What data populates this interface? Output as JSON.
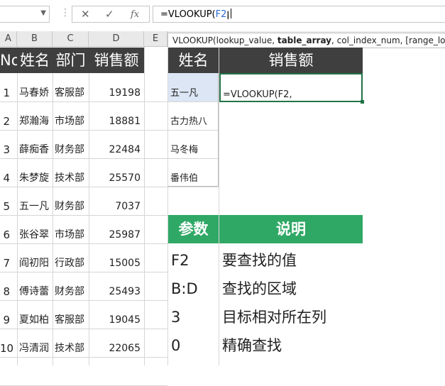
{
  "formula_bar": {
    "cancel_icon": "✕",
    "enter_icon": "✓",
    "fx_icon": "fx",
    "formula_prefix": "=VLOOKUP(",
    "formula_arg": "F2",
    "formula_suffix": ","
  },
  "tooltip": {
    "fn": "VLOOKUP(",
    "arg1": "lookup_value, ",
    "arg2": "table_array",
    "rest": ", col_index_num, [range_looku"
  },
  "columns": [
    "A",
    "B",
    "C",
    "D",
    "E"
  ],
  "left_table": {
    "headers": [
      "No",
      "姓名",
      "部门",
      "销售额"
    ],
    "rows": [
      [
        "1",
        "马春娇",
        "客服部",
        "19198"
      ],
      [
        "2",
        "郑瀚海",
        "市场部",
        "18881"
      ],
      [
        "3",
        "薛痴香",
        "财务部",
        "22484"
      ],
      [
        "4",
        "朱梦旋",
        "技术部",
        "25570"
      ],
      [
        "5",
        "五一凡",
        "财务部",
        "7037"
      ],
      [
        "6",
        "张谷翠",
        "市场部",
        "25987"
      ],
      [
        "7",
        "阎初阳",
        "行政部",
        "15005"
      ],
      [
        "8",
        "傅诗蕾",
        "财务部",
        "25493"
      ],
      [
        "9",
        "夏如柏",
        "客服部",
        "19045"
      ],
      [
        "10",
        "冯清润",
        "技术部",
        "22065"
      ]
    ]
  },
  "lookup_table": {
    "headers": [
      "姓名",
      "销售额"
    ],
    "names": [
      "五一凡",
      "古力热八",
      "马冬梅",
      "番伟伯"
    ],
    "active_formula": "=VLOOKUP(F2,"
  },
  "explain_table": {
    "headers": [
      "参数",
      "说明"
    ],
    "rows": [
      [
        "F2",
        "要查找的值"
      ],
      [
        "B:D",
        "查找的区域"
      ],
      [
        "3",
        "目标相对所在列"
      ],
      [
        "0",
        "精确查找"
      ]
    ]
  },
  "colors": {
    "dark_header": "#3f3f3f",
    "green_header": "#2fa866",
    "selection_border": "#217346",
    "name_cell_fill": "#dce6f4"
  }
}
